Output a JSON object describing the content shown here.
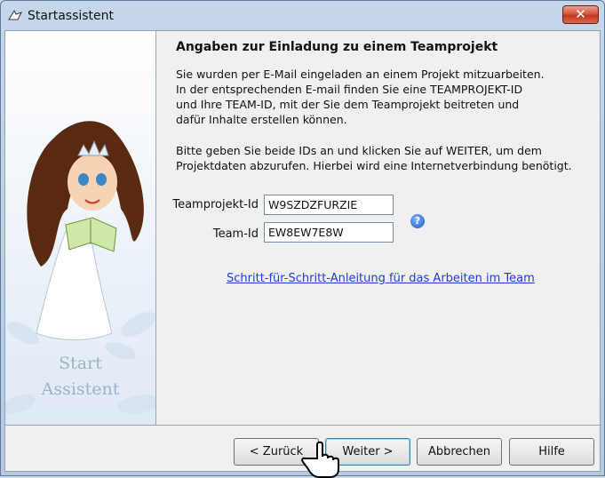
{
  "window": {
    "title": "Startassistent",
    "close_glyph": "✕"
  },
  "sidebar": {
    "brand_line1": "Start",
    "brand_line2": "Assistent"
  },
  "content": {
    "heading": "Angaben zur Einladung zu einem Teamprojekt",
    "para1": "Sie wurden per E-Mail eingeladen an einem Projekt mitzuarbeiten.\nIn der entsprechenden E-mail finden Sie eine TEAMPROJEKT-ID\nund Ihre TEAM-ID, mit der Sie dem Teamprojekt beitreten und\ndafür Inhalte erstellen können.",
    "para2": "Bitte geben Sie beide IDs an und klicken Sie auf WEITER, um dem\nProjektdaten abzurufen. Hierbei wird eine Internetverbindung benötigt.",
    "fields": {
      "project_label": "Teamprojekt-Id",
      "project_value": "W9SZDZFURZIE",
      "team_label": "Team-Id",
      "team_value": "EW8EW7E8W"
    },
    "help_glyph": "?",
    "guide_link": "Schritt-für-Schritt-Anleitung für das Arbeiten im Team"
  },
  "buttons": {
    "back": "< Zurück",
    "next": "Weiter >",
    "cancel": "Abbrechen",
    "help": "Hilfe"
  },
  "icons": [
    "app-icon",
    "close-icon",
    "help-icon",
    "hand-cursor-icon"
  ]
}
